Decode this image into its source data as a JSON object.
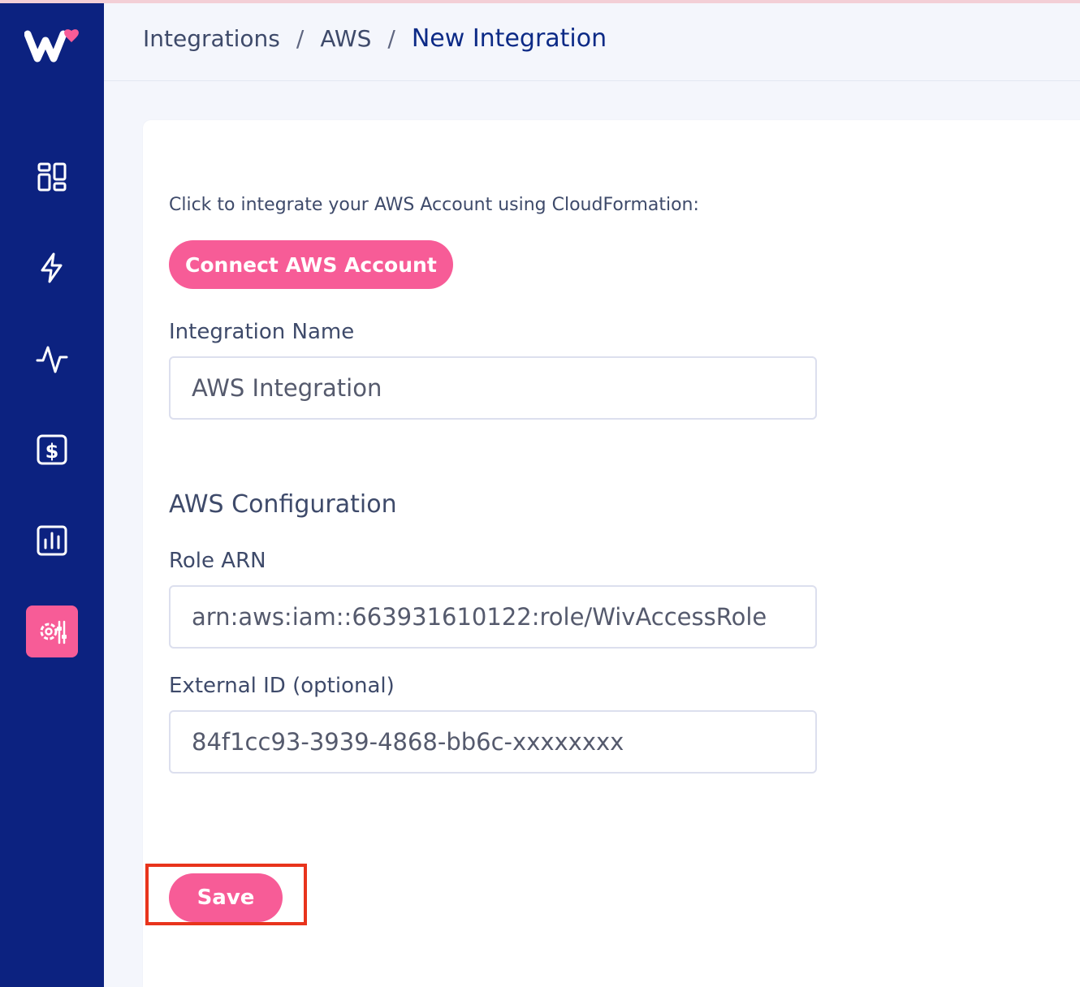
{
  "breadcrumb": {
    "items": [
      "Integrations",
      "AWS"
    ],
    "separator": "/",
    "current": "New Integration"
  },
  "sidebar": {
    "logo": "wiv-logo",
    "items": [
      {
        "icon": "dashboard-icon",
        "active": false
      },
      {
        "icon": "lightning-icon",
        "active": false
      },
      {
        "icon": "activity-icon",
        "active": false
      },
      {
        "icon": "dollar-icon",
        "active": false
      },
      {
        "icon": "bar-chart-icon",
        "active": false
      },
      {
        "icon": "settings-sliders-icon",
        "active": true
      }
    ]
  },
  "form": {
    "intro_text": "Click to integrate your AWS Account using CloudFormation:",
    "connect_button_label": "Connect AWS Account",
    "integration_name_label": "Integration Name",
    "integration_name_value": "AWS Integration",
    "aws_config_title": "AWS Configuration",
    "role_arn_label": "Role ARN",
    "role_arn_value": "arn:aws:iam::663931610122:role/WivAccessRole",
    "external_id_label": "External ID (optional)",
    "external_id_value": "84f1cc93-3939-4868-bb6c-xxxxxxxx",
    "save_button_label": "Save"
  },
  "colors": {
    "sidebar_bg": "#0c2280",
    "accent_pink": "#f75c97",
    "highlight_red": "#e8341c",
    "page_bg": "#f4f6fc"
  }
}
